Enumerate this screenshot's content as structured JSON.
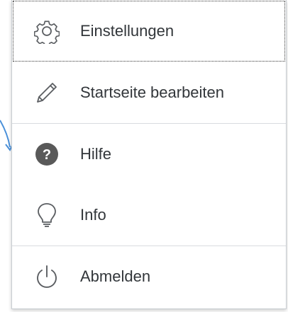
{
  "menu": {
    "items": [
      {
        "label": "Einstellungen",
        "icon": "gear-icon"
      },
      {
        "label": "Startseite bearbeiten",
        "icon": "pencil-icon"
      },
      {
        "label": "Hilfe",
        "icon": "help-icon"
      },
      {
        "label": "Info",
        "icon": "lightbulb-icon"
      },
      {
        "label": "Abmelden",
        "icon": "power-icon"
      }
    ]
  },
  "colors": {
    "text": "#32363a",
    "icon": "#5b5e62",
    "help_icon_fill": "#595959",
    "arrow": "#4a90d9",
    "divider": "#d9dcdf"
  }
}
